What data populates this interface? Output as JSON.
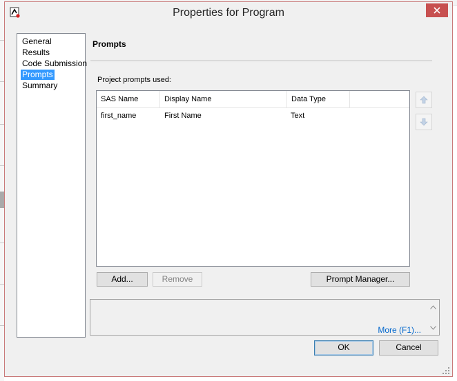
{
  "dialog": {
    "title": "Properties for Program"
  },
  "nav": {
    "items": [
      {
        "label": "General",
        "selected": false
      },
      {
        "label": "Results",
        "selected": false
      },
      {
        "label": "Code Submission",
        "selected": false
      },
      {
        "label": "Prompts",
        "selected": true
      },
      {
        "label": "Summary",
        "selected": false
      }
    ]
  },
  "prompts": {
    "heading": "Prompts",
    "list_label": "Project prompts used:",
    "columns": [
      "SAS Name",
      "Display Name",
      "Data Type"
    ],
    "rows": [
      {
        "sas_name": "first_name",
        "display_name": "First Name",
        "data_type": "Text"
      }
    ],
    "add_label": "Add...",
    "remove_label": "Remove",
    "prompt_manager_label": "Prompt Manager..."
  },
  "help": {
    "more_label": "More (F1)..."
  },
  "footer": {
    "ok_label": "OK",
    "cancel_label": "Cancel"
  },
  "colors": {
    "selection": "#3399ff",
    "close_button": "#c75050",
    "link": "#0066cc"
  }
}
